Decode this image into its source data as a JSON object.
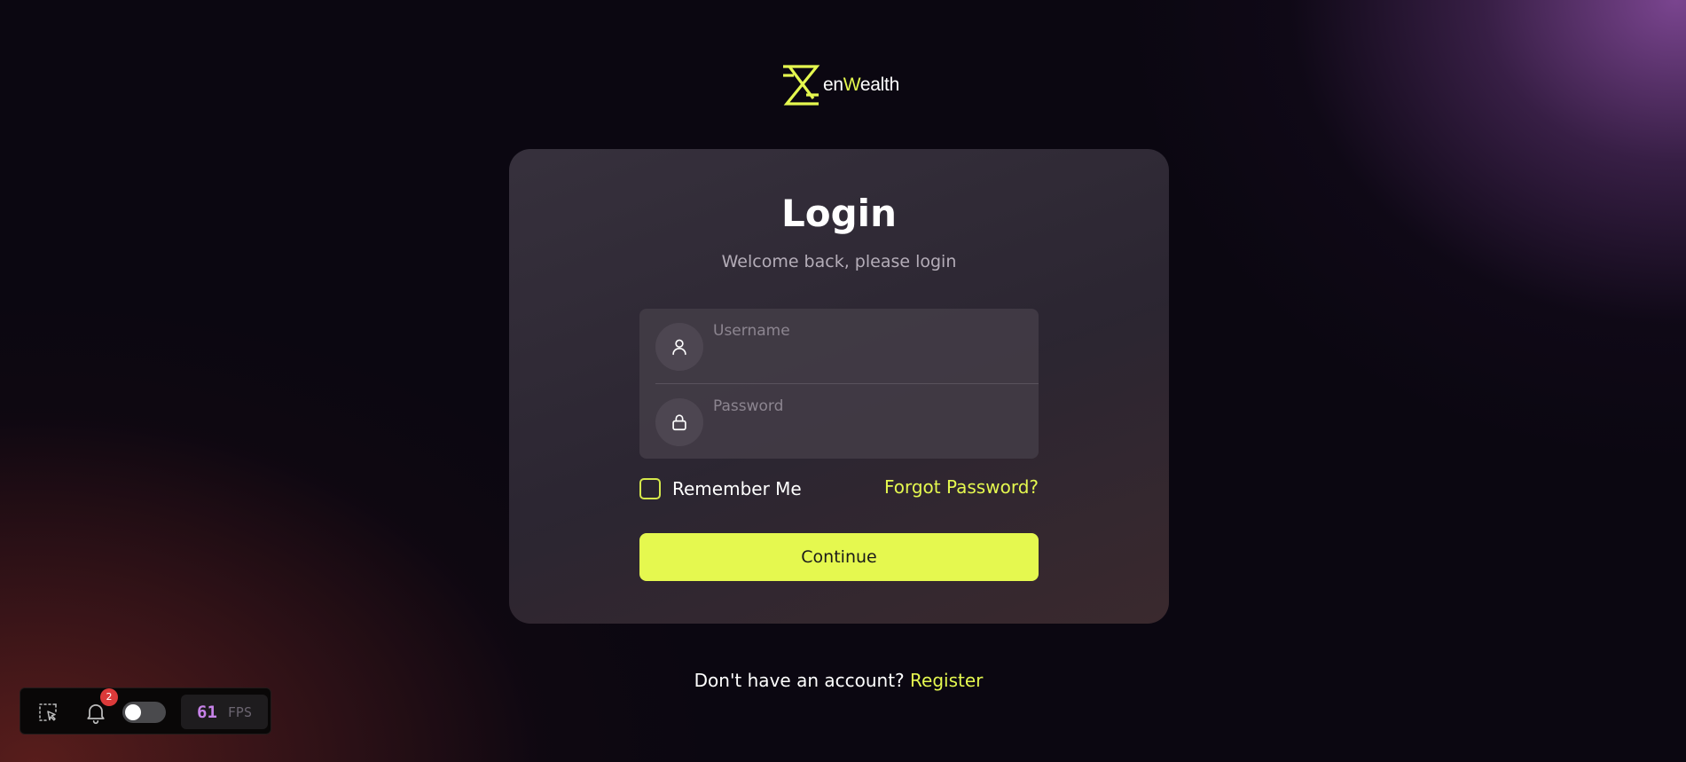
{
  "brand": {
    "logo_prefix": "en",
    "logo_highlight": "W",
    "logo_suffix": "ealth",
    "accent_color": "#e5f84f"
  },
  "login": {
    "title": "Login",
    "subtitle": "Welcome back, please login",
    "username": {
      "placeholder": "Username",
      "value": "",
      "icon": "user-icon"
    },
    "password": {
      "placeholder": "Password",
      "value": "",
      "icon": "lock-icon"
    },
    "remember_label": "Remember Me",
    "remember_checked": false,
    "forgot_label": "Forgot Password?",
    "continue_label": "Continue"
  },
  "footer": {
    "prompt": "Don't have an account?",
    "register_label": "Register"
  },
  "devbar": {
    "notification_count": "2",
    "toggle_on": false,
    "fps_value": "61",
    "fps_label": "FPS",
    "icons": [
      "select-element-icon",
      "bell-icon"
    ]
  }
}
